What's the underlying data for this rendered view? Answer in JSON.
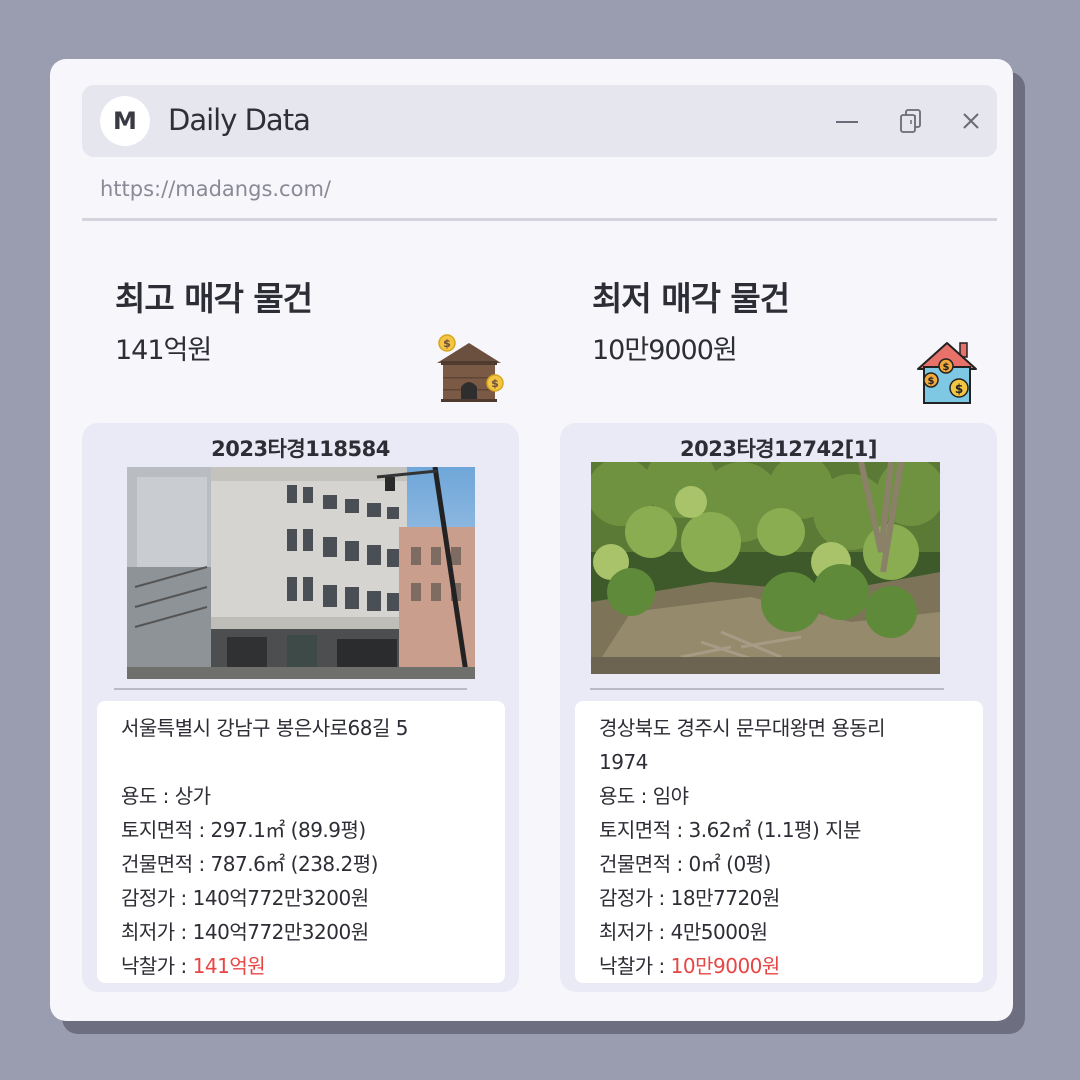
{
  "window": {
    "logo_letter": "M",
    "title": "Daily Data",
    "url": "https://madangs.com/"
  },
  "columns": [
    {
      "heading": "최고 매각 물건",
      "price": "141억원",
      "icon": "house-coin-icon",
      "card": {
        "case_number": "2023타경118584",
        "photo": "building-photo",
        "address": "서울특별시 강남구 봉은사로68길 5",
        "usage": "용도 : 상가",
        "land_area": "토지면적 : 297.1㎡ (89.9평)",
        "building_area": "건물면적 : 787.6㎡ (238.2평)",
        "appraisal": "감정가 : 140억772만3200원",
        "minimum": "최저가 : 140억772만3200원",
        "winning_label": "낙찰가 : ",
        "winning_value": "141억원"
      }
    },
    {
      "heading": "최저 매각 물건",
      "price": "10만9000원",
      "icon": "house-money-icon",
      "card": {
        "case_number": "2023타경12742[1]",
        "photo": "forest-photo",
        "address_line1": "경상북도 경주시 문무대왕면 용동리",
        "address_line2": "1974",
        "usage": "용도 : 임야",
        "land_area": "토지면적 : 3.62㎡ (1.1평) 지분",
        "building_area": "건물면적 : 0㎡ (0평)",
        "appraisal": "감정가 : 18만7720원",
        "minimum": "최저가 : 4만5000원",
        "winning_label": "낙찰가 : ",
        "winning_value": "10만9000원"
      }
    }
  ],
  "colors": {
    "background": "#9a9caf",
    "window": "#f6f6fb",
    "card": "#e9eaf5",
    "highlight": "#e84545"
  }
}
